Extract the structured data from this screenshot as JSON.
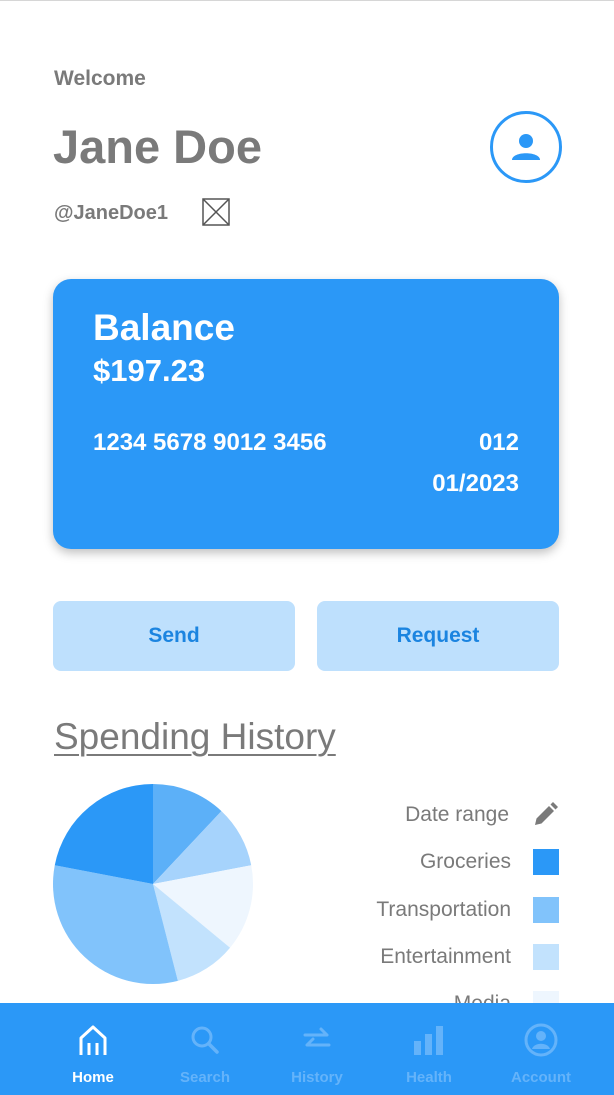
{
  "header": {
    "welcome": "Welcome",
    "name": "Jane Doe",
    "handle": "@JaneDoe1",
    "avatar_icon": "user-icon"
  },
  "card": {
    "title": "Balance",
    "amount": "$197.23",
    "number": "1234 5678 9012 3456",
    "cvv": "012",
    "expiry": "01/2023",
    "color": "#2b98f7"
  },
  "actions": {
    "send_label": "Send",
    "request_label": "Request"
  },
  "spending": {
    "title": "Spending History",
    "date_range_label": "Date range",
    "date_range_icon": "pencil-icon",
    "legend": [
      {
        "label": "Groceries",
        "color": "#2b98f7"
      },
      {
        "label": "Transportation",
        "color": "#81c3fb"
      },
      {
        "label": "Entertainment",
        "color": "#c2e2fd"
      },
      {
        "label": "Media",
        "color": "#eef6fe"
      }
    ]
  },
  "chart_data": {
    "type": "pie",
    "values": [
      12,
      10,
      14,
      10,
      32,
      22
    ],
    "colors": [
      "#5cb0f8",
      "#a6d3fc",
      "#eef6fe",
      "#c2e2fd",
      "#81c3fb",
      "#2b98f7"
    ]
  },
  "nav": {
    "items": [
      {
        "label": "Home",
        "icon": "home-icon",
        "active": true
      },
      {
        "label": "Search",
        "icon": "search-icon",
        "active": false
      },
      {
        "label": "History",
        "icon": "transfer-arrows-icon",
        "active": false
      },
      {
        "label": "Health",
        "icon": "bar-chart-icon",
        "active": false
      },
      {
        "label": "Account",
        "icon": "account-icon",
        "active": false
      }
    ]
  }
}
